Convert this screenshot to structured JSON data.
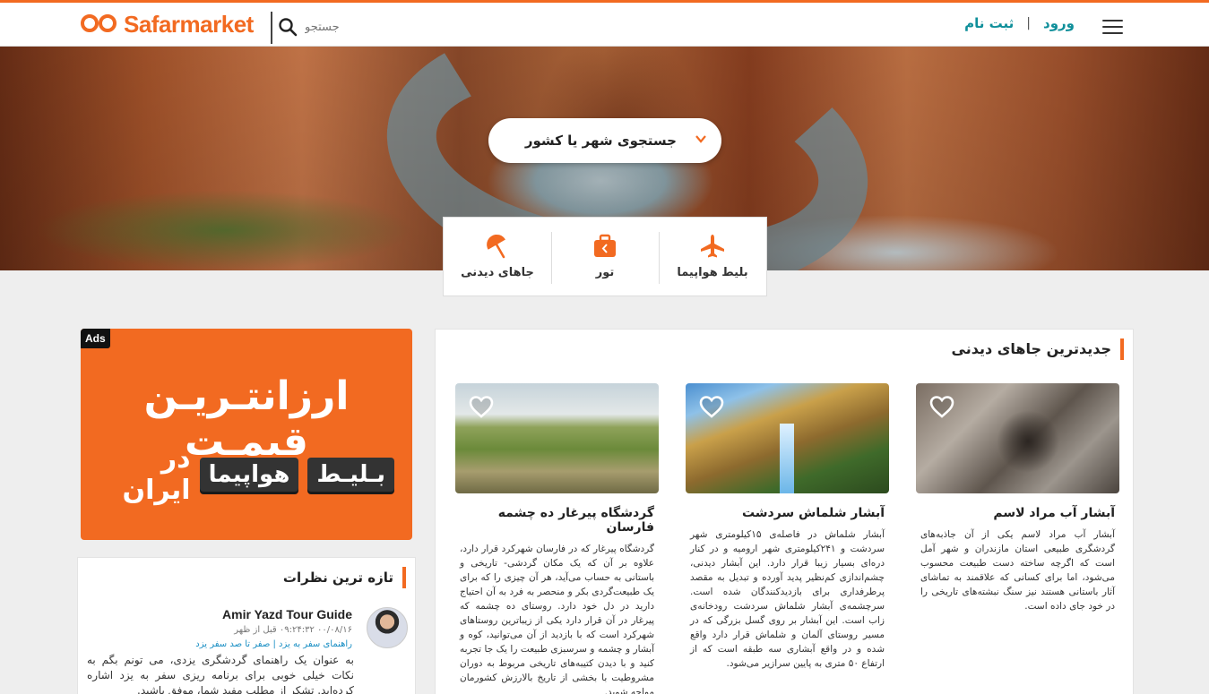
{
  "header": {
    "logo_text": "Safarmarket",
    "search_placeholder": "جستجو",
    "login": "ورود",
    "register": "ثبت نام",
    "separator": "|"
  },
  "hero": {
    "city_search": "جستجوی شهر یا کشور"
  },
  "services": [
    {
      "label": "بلیط هواپیما",
      "icon": "airplane-icon"
    },
    {
      "label": "تور",
      "icon": "suitcase-icon"
    },
    {
      "label": "جاهای دیدنی",
      "icon": "umbrella-icon"
    }
  ],
  "ads": {
    "tag": "Ads",
    "line1": "ارزانتـریـن قیمـت",
    "pill1": "بـلیـط",
    "pill2": "هواپیما",
    "tail": "در ایران"
  },
  "comments": {
    "title": "تازه ترین نظرات",
    "item": {
      "name": "Amir Yazd Tour Guide",
      "time": "۰۰/۰۸/۱۶ ۰۹:۲۴:۳۲ قبل از ظهر",
      "link": "راهنمای سفر به یزد | صفر تا صد سفر یزد",
      "text": "به عنوان یک راهنمای گردشگری یزدی، می تونم بگم به نکات خیلی خوبی برای برنامه ریزی سفر به یزد اشاره کرده‌اید. تشکر از مطلب مفید شما، موفق باشید."
    }
  },
  "places": {
    "title": "جدیدترین جاهای دیدنی",
    "cards": [
      {
        "title": "آبشار آب مراد لاسم",
        "desc": "آبشار آب مراد لاسم یکی از آن جاذبه‌های گردشگری طبیعی استان مازندران و شهر آمل است که اگرچه ساخته دست طبیعت محسوب می‌شود، اما برای کسانی که علاقمند به تماشای آثار باستانی هستند نیز سنگ نبشته‌های تاریخی را در خود جای داده است."
      },
      {
        "title": "آبشار شلماش سردشت",
        "desc": "آبشار شلماش در فاصله‌ی ۱۵کیلومتری شهر سردشت و ۲۴۱کیلومتری شهر ارومیه و در کنار دره‌ای بسیار زیبا قرار دارد. این آبشار دیدنی، چشم‌اندازی کم‌نظیر پدید آورده و تبدیل به مقصد پرطرفداری برای بازدیدکنندگان شده است. سرچشمه‌ی آبشار شلماش سردشت رودخانه‌ی زاب است. این آبشار بر روی گسل بزرگی که در مسیر روستای آلمان و شلماش قرار دارد واقع شده و در واقع آبشاری سه طبقه است که از ارتفاع ۵۰ متری به پایین سرازیر می‌شود."
      },
      {
        "title": "گردشگاه پیرغار ده چشمه فارسان",
        "desc": "گردشگاه پیرغار که در فارسان شهرکرد قرار دارد، علاوه بر آن که یک مکان گردشی- تاریخی و باستانی به حساب می‌آید، هر آن چیزی را که برای یک طبیعت‌گردی بکر و منحصر به فرد به آن احتیاج دارید در دل خود دارد. روستای ده چشمه که پیرغار در آن قرار دارد یکی از زیباترین روستاهای شهرکرد است که با بازدید از آن می‌توانید، کوه و آبشار و چشمه و سرسبزی طبیعت را یک جا تجربه کنید و با دیدن کتیبه‌های تاریخی مربوط به دوران مشروطیت با بخشی از تاریخ بالارزش کشورمان مواجه شوید."
      }
    ]
  },
  "colors": {
    "brand_orange": "#f26a21",
    "teal_link": "#0f8f9a"
  }
}
